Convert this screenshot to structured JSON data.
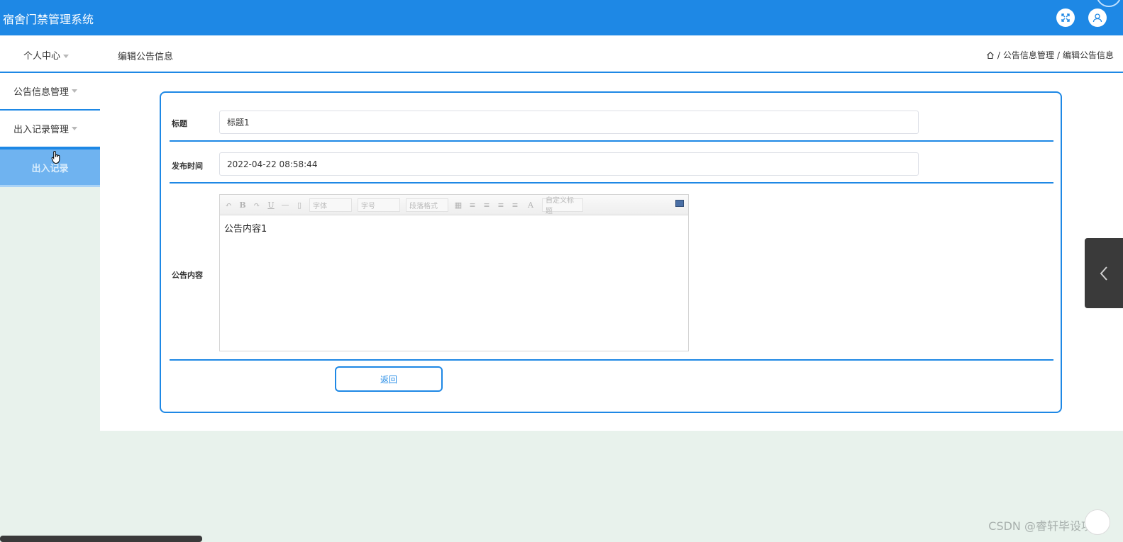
{
  "header": {
    "app_title": "宿舍门禁管理系统"
  },
  "subbar": {
    "personal_center": "个人中心",
    "page_title": "编辑公告信息",
    "breadcrumb": {
      "sep1": "/",
      "item1": "公告信息管理",
      "sep2": "/",
      "item2": "编辑公告信息"
    }
  },
  "sidebar": {
    "items": [
      {
        "label": "公告信息管理"
      },
      {
        "label": "出入记录管理",
        "sub": "出入记录"
      }
    ]
  },
  "form": {
    "title": {
      "label": "标题",
      "value": "标题1"
    },
    "publish_time": {
      "label": "发布时间",
      "value": "2022-04-22 08:58:44"
    },
    "content": {
      "label": "公告内容",
      "value": "公告内容1",
      "toolbar": {
        "font_family": "字体",
        "font_size": "字号",
        "paragraph": "段落格式",
        "custom_title": "自定义标题",
        "bold": "B",
        "italic": "I",
        "underline": "U",
        "hr": "—",
        "font_color": "A"
      }
    },
    "back_button": "返回"
  },
  "watermark": "CSDN @睿轩毕设项目",
  "colors": {
    "primary": "#1e88e5",
    "background": "#e8f2ec",
    "menu_active": "#6fb3f0"
  }
}
